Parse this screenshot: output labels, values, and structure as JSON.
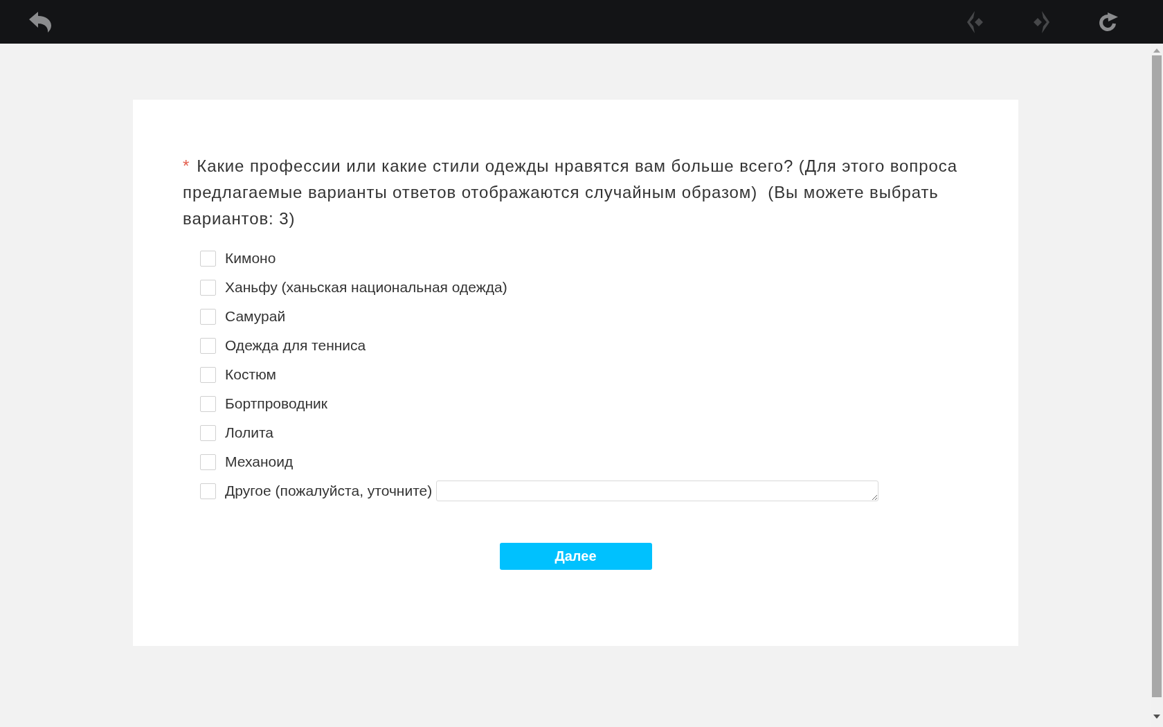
{
  "toolbar": [
    {
      "kind": "back",
      "disabled": false
    },
    {
      "kind": "previous",
      "disabled": true
    },
    {
      "kind": "next",
      "disabled": true
    },
    {
      "kind": "refresh",
      "disabled": false
    }
  ],
  "question": {
    "required_mark": "*",
    "text": "Какие профессии или какие стили одежды нравятся вам больше всего? (Для этого вопроса предлагаемые варианты ответов отображаются случайным образом)  (Вы можете выбрать вариантов: 3)"
  },
  "options": [
    {
      "kind": "choice",
      "label": "Кимоно",
      "checked": false
    },
    {
      "kind": "choice",
      "label": "Ханьфу (ханьская национальная одежда)",
      "checked": false
    },
    {
      "kind": "choice",
      "label": "Самурай",
      "checked": false
    },
    {
      "kind": "choice",
      "label": "Одежда для тенниса",
      "checked": false
    },
    {
      "kind": "choice",
      "label": "Костюм",
      "checked": false
    },
    {
      "kind": "choice",
      "label": "Бортпроводник",
      "checked": false
    },
    {
      "kind": "choice",
      "label": "Лолита",
      "checked": false
    },
    {
      "kind": "choice",
      "label": "Механоид",
      "checked": false
    },
    {
      "kind": "choice-with-field",
      "label": "Другое (пожалуйста, уточните)",
      "checked": false
    }
  ],
  "next_button": {
    "label": "Далее"
  }
}
